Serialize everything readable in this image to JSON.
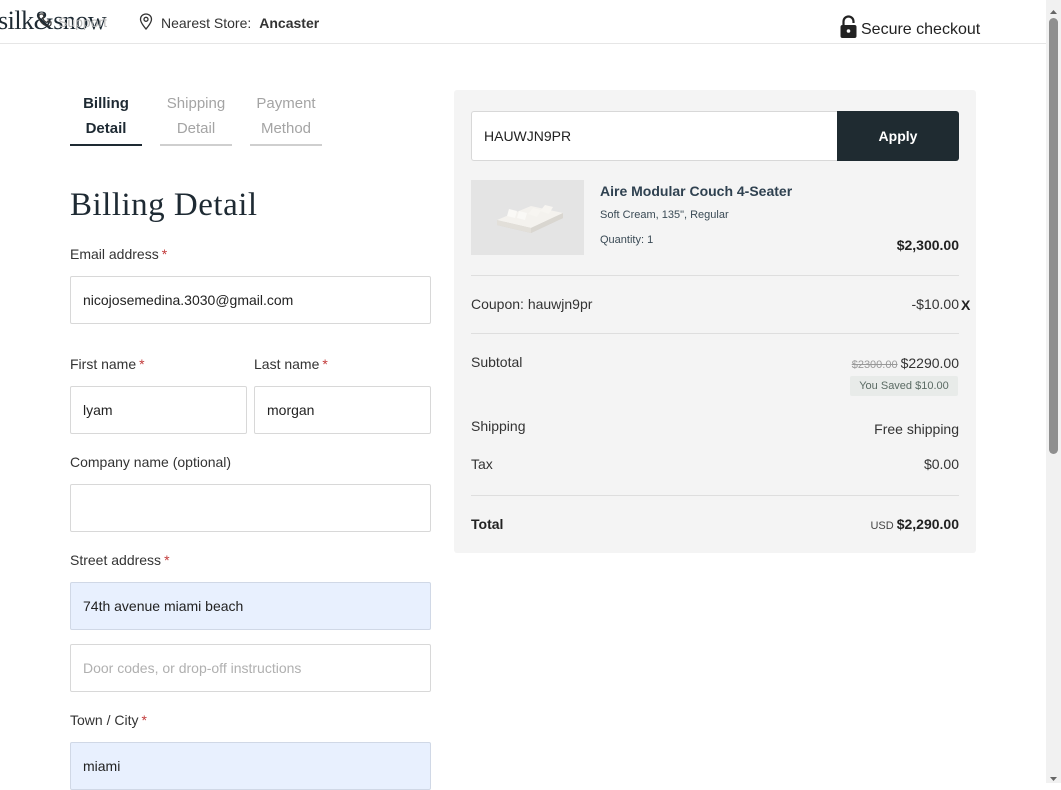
{
  "header": {
    "logo_text": "silk&snow",
    "support_label": "Support",
    "store_prefix": "Nearest Store:",
    "store_name": "Ancaster",
    "secure_label": "Secure checkout"
  },
  "steps": [
    {
      "line1": "Billing",
      "line2": "Detail",
      "active": true
    },
    {
      "line1": "Shipping",
      "line2": "Detail",
      "active": false
    },
    {
      "line1": "Payment",
      "line2": "Method",
      "active": false
    }
  ],
  "form": {
    "title": "Billing Detail",
    "email": {
      "label": "Email address",
      "value": "nicojosemedina.3030@gmail.com"
    },
    "first_name": {
      "label": "First name",
      "value": "lyam"
    },
    "last_name": {
      "label": "Last name",
      "value": "morgan"
    },
    "company": {
      "label": "Company name (optional)",
      "value": ""
    },
    "street": {
      "label": "Street address",
      "value": "74th avenue miami beach",
      "line2_placeholder": "Door codes, or drop-off instructions"
    },
    "city": {
      "label": "Town / City",
      "value": "miami"
    },
    "required_mark": "*"
  },
  "summary": {
    "coupon_input_value": "HAUWJN9PR",
    "apply_label": "Apply",
    "product": {
      "name": "Aire Modular Couch 4-Seater",
      "variant": "Soft Cream, 135\", Regular",
      "quantity": "Quantity: 1",
      "price": "$2,300.00"
    },
    "coupon_label": "Coupon: hauwjn9pr",
    "coupon_value": "-$10.00",
    "coupon_remove": "X",
    "subtotal_label": "Subtotal",
    "subtotal_original": "$2300.00",
    "subtotal_value": "$2290.00",
    "saved_badge": "You Saved $10.00",
    "shipping_label": "Shipping",
    "shipping_value": "Free shipping",
    "tax_label": "Tax",
    "tax_value": "$0.00",
    "total_label": "Total",
    "total_currency": "USD",
    "total_value": "$2,290.00"
  },
  "colors": {
    "brand_dark": "#1f2b31",
    "required": "#c23b3b",
    "autofill": "#e8f0fe",
    "panel": "#f4f4f4"
  }
}
